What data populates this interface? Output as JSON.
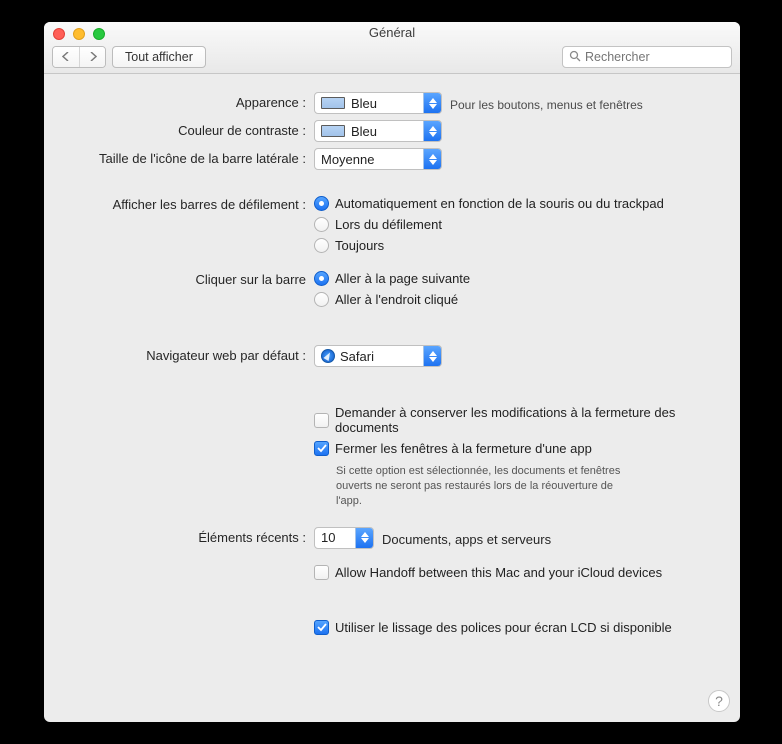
{
  "window": {
    "title": "Général"
  },
  "toolbar": {
    "show_all_label": "Tout afficher",
    "search_placeholder": "Rechercher"
  },
  "labels": {
    "appearance": "Apparence :",
    "highlight": "Couleur de contraste :",
    "sidebar_icon": "Taille de l'icône de la barre latérale :",
    "scrollbars": "Afficher les barres de défilement :",
    "click_scroll": "Cliquer sur la barre",
    "default_browser": "Navigateur web par défaut :",
    "recent": "Éléments récents :"
  },
  "values": {
    "appearance": "Bleu",
    "highlight": "Bleu",
    "sidebar_icon": "Moyenne",
    "default_browser": "Safari",
    "recent": "10"
  },
  "hints": {
    "appearance": "Pour les boutons, menus et fenêtres",
    "recent": "Documents, apps et serveurs",
    "close_windows_note": "Si cette option est sélectionnée, les documents et fenêtres ouverts ne seront pas restaurés lors de la réouverture de l'app."
  },
  "radios": {
    "scroll_auto": "Automatiquement en fonction de la souris ou du trackpad",
    "scroll_when": "Lors du défilement",
    "scroll_always": "Toujours",
    "click_next": "Aller à la page suivante",
    "click_spot": "Aller à l'endroit cliqué"
  },
  "checks": {
    "ask_save": "Demander à conserver les modifications à la fermeture des documents",
    "close_windows": "Fermer les fenêtres à la fermeture d'une app",
    "handoff": "Allow Handoff between this Mac and your iCloud devices",
    "font_smoothing": "Utiliser le lissage des polices pour écran LCD si disponible"
  }
}
